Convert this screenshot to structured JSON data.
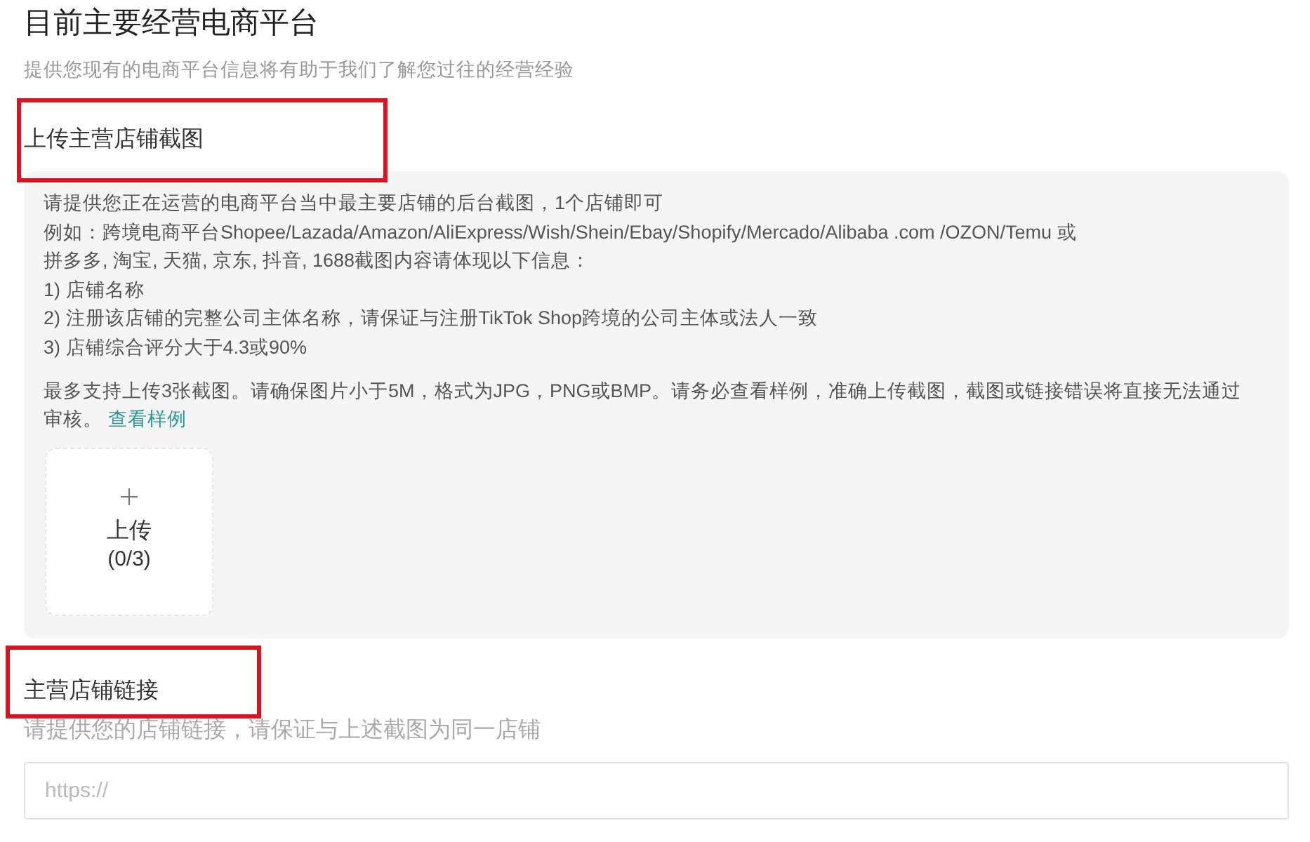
{
  "header": {
    "title": "目前主要经营电商平台",
    "subtitle": "提供您现有的电商平台信息将有助于我们了解您过往的经营经验"
  },
  "sections": [
    {
      "kind": "upload",
      "heading": "上传主营店铺截图",
      "highlighted": true,
      "instructions": [
        "请提供您正在运营的电商平台当中最主要店铺的后台截图，1个店铺即可",
        "例如：跨境电商平台Shopee/Lazada/Amazon/AliExpress/Wish/Shein/Ebay/Shopify/Mercado/Alibaba .com /OZON/Temu 或",
        "拼多多, 淘宝, 天猫, 京东, 抖音, 1688截图内容请体现以下信息：",
        "1) 店铺名称",
        "2) 注册该店铺的完整公司主体名称，请保证与注册TikTok Shop跨境的公司主体或法人一致",
        "3) 店铺综合评分大于4.3或90%"
      ],
      "note": "最多支持上传3张截图。请确保图片小于5M，格式为JPG，PNG或BMP。请务必查看样例，准确上传截图，截图或链接错误将直接无法通过审核。",
      "note_link": "查看样例",
      "upload": {
        "label": "上传",
        "count": "(0/3)"
      }
    },
    {
      "kind": "link",
      "heading": "主营店铺链接",
      "highlighted": true,
      "hint": "请提供您的店铺链接，请保证与上述截图为同一店铺",
      "input": {
        "placeholder": "https://"
      }
    }
  ]
}
